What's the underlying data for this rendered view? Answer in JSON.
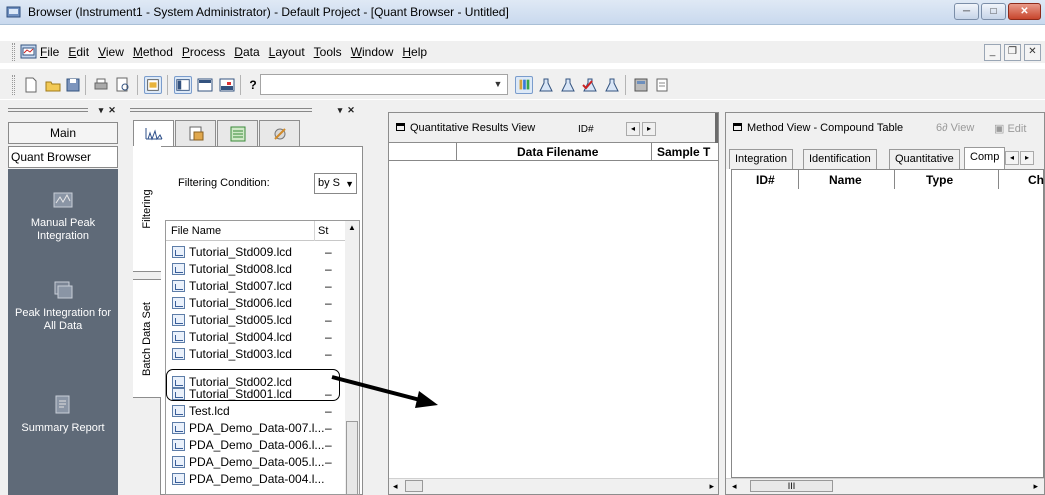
{
  "window": {
    "title": "Browser (Instrument1 - System Administrator) - Default Project - [Quant Browser - Untitled]",
    "btn_minimize": "─",
    "btn_maximize": "□",
    "btn_close": "✕"
  },
  "menu": {
    "items": [
      "File",
      "Edit",
      "View",
      "Method",
      "Process",
      "Data",
      "Layout",
      "Tools",
      "Window",
      "Help"
    ],
    "mdi_minimize": "_",
    "mdi_restore": "❐",
    "mdi_close": "✕"
  },
  "toolbar": {
    "help_label": "?",
    "combo_value": ""
  },
  "nav": {
    "main_label": "Main",
    "quant_label": "Quant Browser",
    "items": [
      {
        "label": "Manual Peak Integration",
        "icon": "manual-integration-icon"
      },
      {
        "label": "Peak Integration for All Data",
        "icon": "batch-integration-icon"
      },
      {
        "label": "Summary Report",
        "icon": "summary-report-icon"
      }
    ]
  },
  "dataset": {
    "vtab_filtering": "Filtering",
    "vtab_batch": "Batch Data Set",
    "filter_label": "Filtering Condition:",
    "filter_value": "by S",
    "col_file_name": "File Name",
    "col_status": "St",
    "files": [
      {
        "name": "Tutorial_Std009.lcd",
        "status": "–"
      },
      {
        "name": "Tutorial_Std008.lcd",
        "status": "–"
      },
      {
        "name": "Tutorial_Std007.lcd",
        "status": "–"
      },
      {
        "name": "Tutorial_Std006.lcd",
        "status": "–"
      },
      {
        "name": "Tutorial_Std005.lcd",
        "status": "–"
      },
      {
        "name": "Tutorial_Std004.lcd",
        "status": "–"
      },
      {
        "name": "Tutorial_Std003.lcd",
        "status": "–"
      },
      {
        "name": "Tutorial_Std002.lcd",
        "status": ""
      },
      {
        "name": "Tutorial_Std001.lcd",
        "status": "–"
      },
      {
        "name": "Test.lcd",
        "status": "–"
      },
      {
        "name": "PDA_Demo_Data-007.l...",
        "status": "–"
      },
      {
        "name": "PDA_Demo_Data-006.l...",
        "status": "–"
      },
      {
        "name": "PDA_Demo_Data-005.l...",
        "status": "–"
      },
      {
        "name": "PDA_Demo_Data-004.l...",
        "status": ""
      }
    ]
  },
  "quant_results": {
    "title": "Quantitative Results View",
    "id_label": "ID#",
    "col_data_filename": "Data Filename",
    "col_sample": "Sample T"
  },
  "method_view": {
    "title": "Method View - Compound Table",
    "view_label": "View",
    "edit_label": "Edit",
    "tabs": [
      "Integration",
      "Identification",
      "Quantitative",
      "Comp"
    ],
    "cols": [
      "ID#",
      "Name",
      "Type",
      "Ch"
    ],
    "scroll_label": "III"
  }
}
